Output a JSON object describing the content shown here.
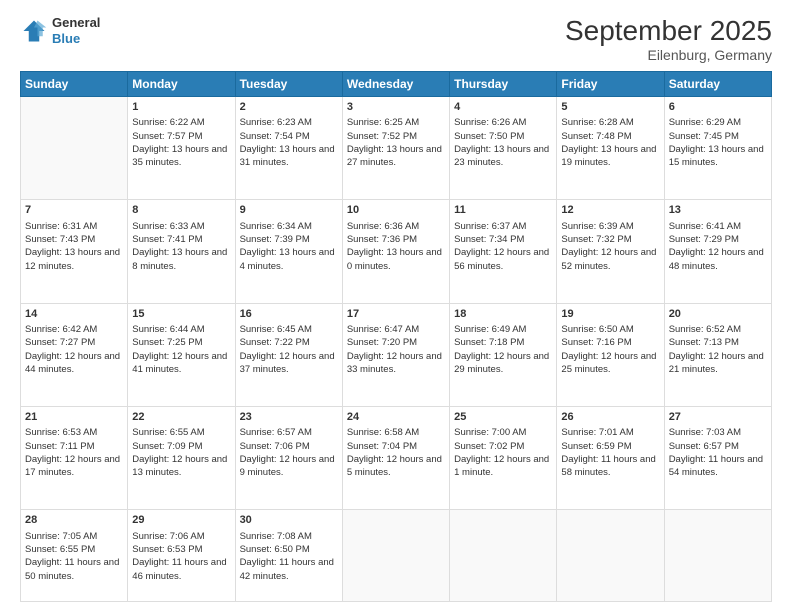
{
  "header": {
    "logo_general": "General",
    "logo_blue": "Blue",
    "title": "September 2025",
    "subtitle": "Eilenburg, Germany"
  },
  "days_of_week": [
    "Sunday",
    "Monday",
    "Tuesday",
    "Wednesday",
    "Thursday",
    "Friday",
    "Saturday"
  ],
  "weeks": [
    [
      {
        "day": "",
        "sunrise": "",
        "sunset": "",
        "daylight": ""
      },
      {
        "day": "1",
        "sunrise": "Sunrise: 6:22 AM",
        "sunset": "Sunset: 7:57 PM",
        "daylight": "Daylight: 13 hours and 35 minutes."
      },
      {
        "day": "2",
        "sunrise": "Sunrise: 6:23 AM",
        "sunset": "Sunset: 7:54 PM",
        "daylight": "Daylight: 13 hours and 31 minutes."
      },
      {
        "day": "3",
        "sunrise": "Sunrise: 6:25 AM",
        "sunset": "Sunset: 7:52 PM",
        "daylight": "Daylight: 13 hours and 27 minutes."
      },
      {
        "day": "4",
        "sunrise": "Sunrise: 6:26 AM",
        "sunset": "Sunset: 7:50 PM",
        "daylight": "Daylight: 13 hours and 23 minutes."
      },
      {
        "day": "5",
        "sunrise": "Sunrise: 6:28 AM",
        "sunset": "Sunset: 7:48 PM",
        "daylight": "Daylight: 13 hours and 19 minutes."
      },
      {
        "day": "6",
        "sunrise": "Sunrise: 6:29 AM",
        "sunset": "Sunset: 7:45 PM",
        "daylight": "Daylight: 13 hours and 15 minutes."
      }
    ],
    [
      {
        "day": "7",
        "sunrise": "Sunrise: 6:31 AM",
        "sunset": "Sunset: 7:43 PM",
        "daylight": "Daylight: 13 hours and 12 minutes."
      },
      {
        "day": "8",
        "sunrise": "Sunrise: 6:33 AM",
        "sunset": "Sunset: 7:41 PM",
        "daylight": "Daylight: 13 hours and 8 minutes."
      },
      {
        "day": "9",
        "sunrise": "Sunrise: 6:34 AM",
        "sunset": "Sunset: 7:39 PM",
        "daylight": "Daylight: 13 hours and 4 minutes."
      },
      {
        "day": "10",
        "sunrise": "Sunrise: 6:36 AM",
        "sunset": "Sunset: 7:36 PM",
        "daylight": "Daylight: 13 hours and 0 minutes."
      },
      {
        "day": "11",
        "sunrise": "Sunrise: 6:37 AM",
        "sunset": "Sunset: 7:34 PM",
        "daylight": "Daylight: 12 hours and 56 minutes."
      },
      {
        "day": "12",
        "sunrise": "Sunrise: 6:39 AM",
        "sunset": "Sunset: 7:32 PM",
        "daylight": "Daylight: 12 hours and 52 minutes."
      },
      {
        "day": "13",
        "sunrise": "Sunrise: 6:41 AM",
        "sunset": "Sunset: 7:29 PM",
        "daylight": "Daylight: 12 hours and 48 minutes."
      }
    ],
    [
      {
        "day": "14",
        "sunrise": "Sunrise: 6:42 AM",
        "sunset": "Sunset: 7:27 PM",
        "daylight": "Daylight: 12 hours and 44 minutes."
      },
      {
        "day": "15",
        "sunrise": "Sunrise: 6:44 AM",
        "sunset": "Sunset: 7:25 PM",
        "daylight": "Daylight: 12 hours and 41 minutes."
      },
      {
        "day": "16",
        "sunrise": "Sunrise: 6:45 AM",
        "sunset": "Sunset: 7:22 PM",
        "daylight": "Daylight: 12 hours and 37 minutes."
      },
      {
        "day": "17",
        "sunrise": "Sunrise: 6:47 AM",
        "sunset": "Sunset: 7:20 PM",
        "daylight": "Daylight: 12 hours and 33 minutes."
      },
      {
        "day": "18",
        "sunrise": "Sunrise: 6:49 AM",
        "sunset": "Sunset: 7:18 PM",
        "daylight": "Daylight: 12 hours and 29 minutes."
      },
      {
        "day": "19",
        "sunrise": "Sunrise: 6:50 AM",
        "sunset": "Sunset: 7:16 PM",
        "daylight": "Daylight: 12 hours and 25 minutes."
      },
      {
        "day": "20",
        "sunrise": "Sunrise: 6:52 AM",
        "sunset": "Sunset: 7:13 PM",
        "daylight": "Daylight: 12 hours and 21 minutes."
      }
    ],
    [
      {
        "day": "21",
        "sunrise": "Sunrise: 6:53 AM",
        "sunset": "Sunset: 7:11 PM",
        "daylight": "Daylight: 12 hours and 17 minutes."
      },
      {
        "day": "22",
        "sunrise": "Sunrise: 6:55 AM",
        "sunset": "Sunset: 7:09 PM",
        "daylight": "Daylight: 12 hours and 13 minutes."
      },
      {
        "day": "23",
        "sunrise": "Sunrise: 6:57 AM",
        "sunset": "Sunset: 7:06 PM",
        "daylight": "Daylight: 12 hours and 9 minutes."
      },
      {
        "day": "24",
        "sunrise": "Sunrise: 6:58 AM",
        "sunset": "Sunset: 7:04 PM",
        "daylight": "Daylight: 12 hours and 5 minutes."
      },
      {
        "day": "25",
        "sunrise": "Sunrise: 7:00 AM",
        "sunset": "Sunset: 7:02 PM",
        "daylight": "Daylight: 12 hours and 1 minute."
      },
      {
        "day": "26",
        "sunrise": "Sunrise: 7:01 AM",
        "sunset": "Sunset: 6:59 PM",
        "daylight": "Daylight: 11 hours and 58 minutes."
      },
      {
        "day": "27",
        "sunrise": "Sunrise: 7:03 AM",
        "sunset": "Sunset: 6:57 PM",
        "daylight": "Daylight: 11 hours and 54 minutes."
      }
    ],
    [
      {
        "day": "28",
        "sunrise": "Sunrise: 7:05 AM",
        "sunset": "Sunset: 6:55 PM",
        "daylight": "Daylight: 11 hours and 50 minutes."
      },
      {
        "day": "29",
        "sunrise": "Sunrise: 7:06 AM",
        "sunset": "Sunset: 6:53 PM",
        "daylight": "Daylight: 11 hours and 46 minutes."
      },
      {
        "day": "30",
        "sunrise": "Sunrise: 7:08 AM",
        "sunset": "Sunset: 6:50 PM",
        "daylight": "Daylight: 11 hours and 42 minutes."
      },
      {
        "day": "",
        "sunrise": "",
        "sunset": "",
        "daylight": ""
      },
      {
        "day": "",
        "sunrise": "",
        "sunset": "",
        "daylight": ""
      },
      {
        "day": "",
        "sunrise": "",
        "sunset": "",
        "daylight": ""
      },
      {
        "day": "",
        "sunrise": "",
        "sunset": "",
        "daylight": ""
      }
    ]
  ]
}
